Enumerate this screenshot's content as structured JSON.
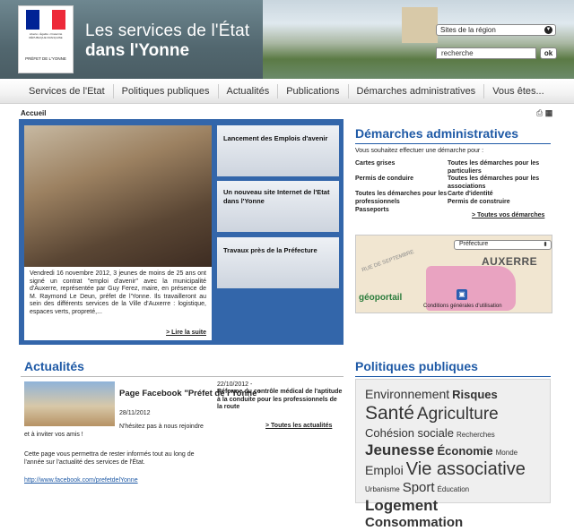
{
  "header": {
    "logo_sub": "Liberté • Égalité • Fraternité RÉPUBLIQUE FRANÇAISE",
    "logo_prefet": "PRÉFET DE L'YONNE",
    "title_line1": "Les services de l'État",
    "title_line2": "dans l'Yonne",
    "region_select": "Sites de la région",
    "search_value": "recherche",
    "search_button": "ok",
    "colors": {
      "marianne_blue": "#002395",
      "marianne_red": "#ED2939",
      "brand_blue": "#1f5aa6",
      "slider_blue": "#3366aa"
    }
  },
  "nav": {
    "items": [
      "Services de l'Etat",
      "Politiques publiques",
      "Actualités",
      "Publications",
      "Démarches administratives",
      "Vous êtes..."
    ]
  },
  "breadcrumb": "Accueil",
  "tools": {
    "print_icon": "printer-icon",
    "text_size_icon": "text-size-icon"
  },
  "slider": {
    "caption": "Vendredi 16 novembre 2012, 3 jeunes de moins de 25 ans ont signé un contrat \"emploi d'avenir\" avec la municipalité d'Auxerre, représentée par Guy Ferez, maire, en présence de M. Raymond Le Deun, préfet de l'Yonne. Ils travailleront au sein des différents services de la Ville d'Auxerre : logistique, espaces verts, propreté,...",
    "more": "> Lire la suite",
    "tabs": [
      "Lancement des Emplois d'avenir",
      "Un nouveau site Internet de l'Etat dans l'Yonne",
      "Travaux près de la Préfecture"
    ]
  },
  "demarches": {
    "title": "Démarches administratives",
    "intro": "Vous souhaitez effectuer une démarche pour :",
    "left": [
      "Cartes grises",
      "Permis de conduire",
      "Toutes les démarches pour les professionnels",
      "Passeports"
    ],
    "right": [
      "Toutes les démarches pour les particuliers",
      "Toutes les démarches pour les associations",
      "Carte d'identité",
      "Permis de construire"
    ],
    "all": "> Toutes vos démarches"
  },
  "map": {
    "select": "Préfecture",
    "city": "AUXERRE",
    "street": "RUE DE SEPTEMBRE",
    "logo": "géoportail",
    "conditions": "Conditions générales d'utilisation"
  },
  "actualites": {
    "title": "Actualités",
    "fb_title": "Page Facebook \"Préfet de l'Yonne\"",
    "fb_date": "28/11/2012",
    "nhesitez": "N'hésitez pas à nous rejoindre",
    "invite": "et à inviter vos amis !",
    "body": "Cette page vous permettra de rester informés tout au long de l'année sur l'actualité des services de l'État.",
    "url": "http://www.facebook.com/prefetdelYonne",
    "news_date": "22/10/2012 -",
    "news_title": "Réforme du contrôle médical de l'aptitude à la conduite pour les professionnels de la route",
    "all": "> Toutes les actualités"
  },
  "politiques": {
    "title": "Politiques publiques",
    "tags": [
      {
        "label": "Environnement",
        "size": 14,
        "bold": false
      },
      {
        "label": "Risques",
        "size": 13,
        "bold": true
      },
      {
        "label": "Santé",
        "size": 21,
        "bold": false
      },
      {
        "label": "Agriculture",
        "size": 19,
        "bold": false
      },
      {
        "label": "Cohésion sociale",
        "size": 13,
        "bold": false
      },
      {
        "label": "Recherches",
        "size": 8,
        "bold": false
      },
      {
        "label": "Jeunesse",
        "size": 17,
        "bold": true
      },
      {
        "label": "Économie",
        "size": 13,
        "bold": true
      },
      {
        "label": "Monde",
        "size": 8,
        "bold": false
      },
      {
        "label": "Emploi",
        "size": 14,
        "bold": false
      },
      {
        "label": "Vie associative",
        "size": 20,
        "bold": false
      },
      {
        "label": "Urbanisme",
        "size": 8,
        "bold": false
      },
      {
        "label": "Sport",
        "size": 15,
        "bold": false
      },
      {
        "label": "Éducation",
        "size": 8,
        "bold": false
      },
      {
        "label": "Logement",
        "size": 17,
        "bold": true
      },
      {
        "label": "Consommation",
        "size": 15,
        "bold": true
      }
    ]
  }
}
